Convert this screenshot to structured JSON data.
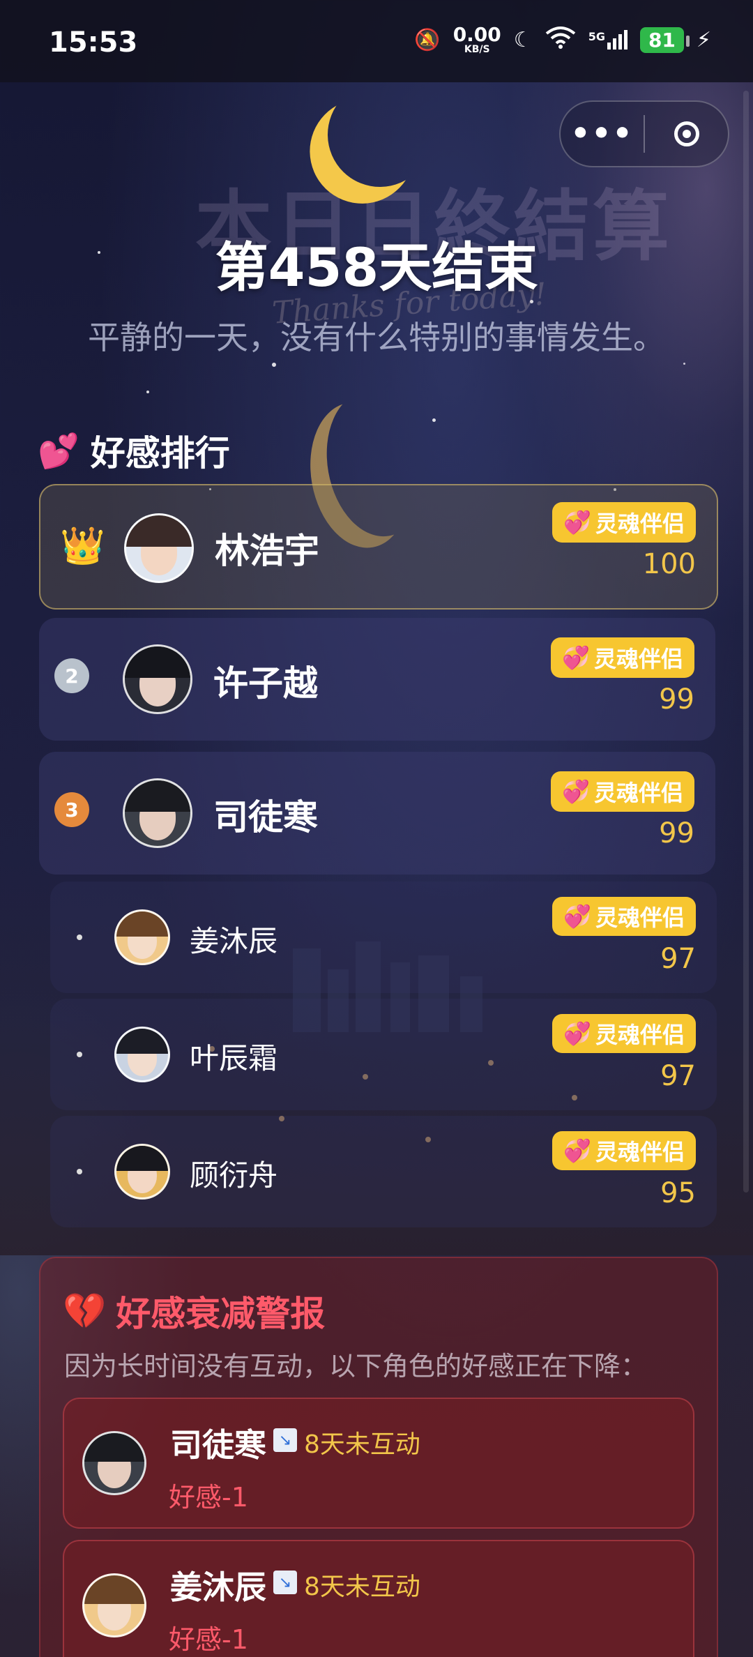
{
  "status_bar": {
    "time": "15:53",
    "net_speed_value": "0.00",
    "net_speed_unit": "KB/S",
    "network": "5G",
    "battery": "81"
  },
  "capsule": {
    "more_label": "•••"
  },
  "header": {
    "day_title": "第458天结束",
    "subtitle": "平静的一天，没有什么特别的事情发生。",
    "bg_title": "本日日終結算",
    "bg_thanks": "Thanks for today!"
  },
  "ranking": {
    "title": "好感排行",
    "items": [
      {
        "rank": "1",
        "name": "林浩宇",
        "badge": "灵魂伴侣",
        "score": "100"
      },
      {
        "rank": "2",
        "name": "许子越",
        "badge": "灵魂伴侣",
        "score": "99"
      },
      {
        "rank": "3",
        "name": "司徒寒",
        "badge": "灵魂伴侣",
        "score": "99"
      },
      {
        "rank": "·",
        "name": "姜沐辰",
        "badge": "灵魂伴侣",
        "score": "97"
      },
      {
        "rank": "·",
        "name": "叶辰霜",
        "badge": "灵魂伴侣",
        "score": "97"
      },
      {
        "rank": "·",
        "name": "顾衍舟",
        "badge": "灵魂伴侣",
        "score": "95"
      }
    ]
  },
  "warning": {
    "title": "好感衰减警报",
    "description": "因为长时间没有互动，以下角色的好感正在下降：",
    "items": [
      {
        "name": "司徒寒",
        "days": "8天未互动",
        "delta": "好感-1"
      },
      {
        "name": "姜沐辰",
        "days": "8天未互动",
        "delta": "好感-1"
      }
    ]
  },
  "colors": {
    "badge_bg": "#f7c630",
    "score": "#f2c64a",
    "warn_red": "#ff5a6a",
    "battery_green": "#2fb84a"
  }
}
